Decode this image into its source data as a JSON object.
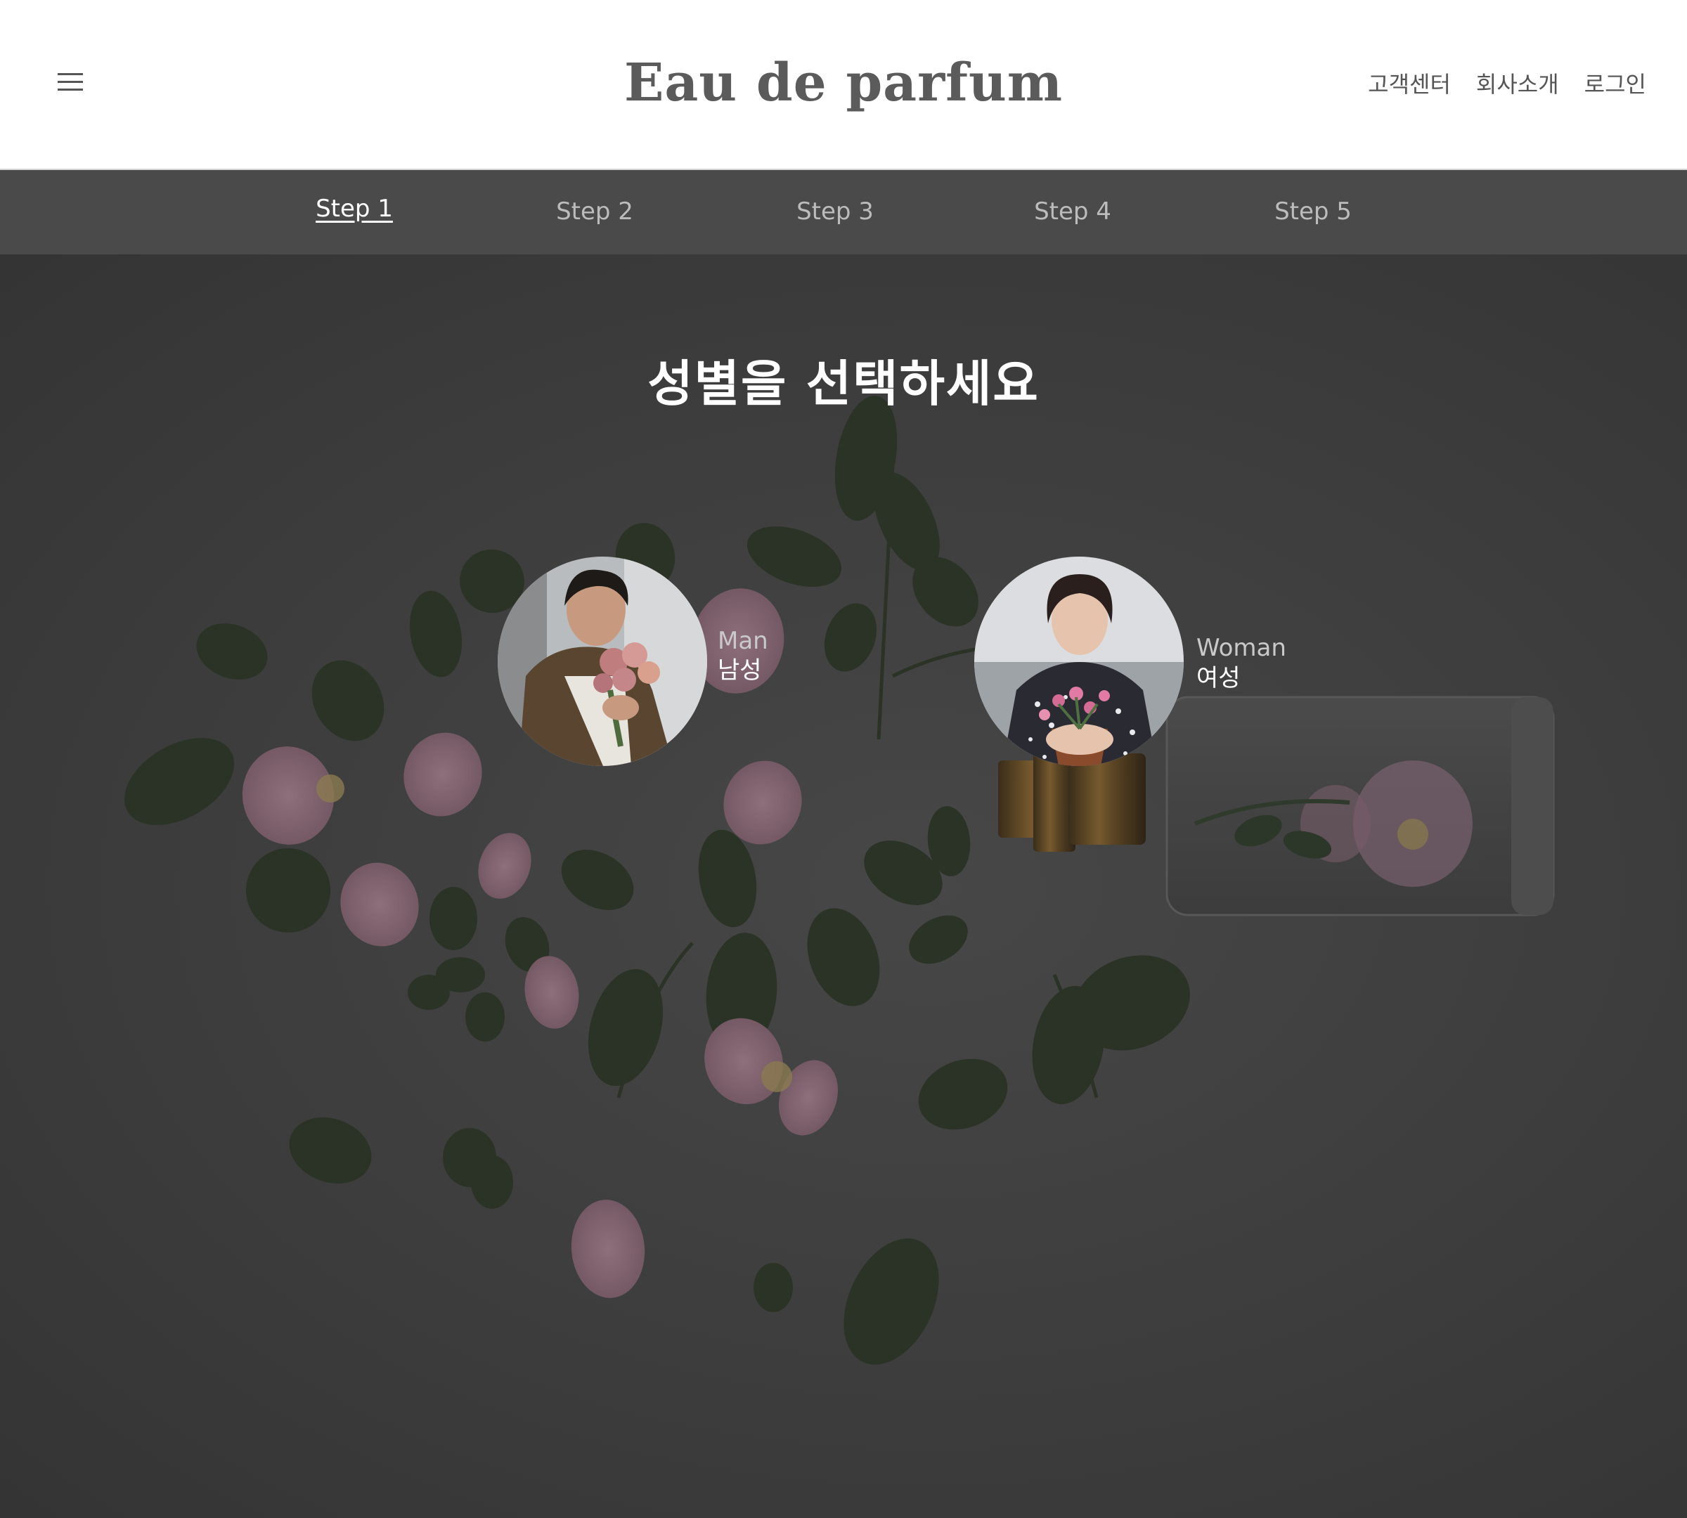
{
  "header": {
    "brand": "Eau de parfum",
    "nav": [
      {
        "label": "고객센터"
      },
      {
        "label": "회사소개"
      },
      {
        "label": "로그인"
      }
    ]
  },
  "steps": [
    {
      "label": "Step 1",
      "active": true
    },
    {
      "label": "Step 2",
      "active": false
    },
    {
      "label": "Step 3",
      "active": false
    },
    {
      "label": "Step 4",
      "active": false
    },
    {
      "label": "Step 5",
      "active": false
    }
  ],
  "main": {
    "title": "성별을 선택하세요",
    "options": [
      {
        "label_en": "Man",
        "label_ko": "남성"
      },
      {
        "label_en": "Woman",
        "label_ko": "여성"
      }
    ]
  },
  "colors": {
    "header_bg": "#ffffff",
    "step_bar_bg": "#4a4a4a",
    "hero_overlay": "#3d3d3d",
    "active_step": "#ffffff",
    "inactive_step": "#bcbcbc"
  }
}
